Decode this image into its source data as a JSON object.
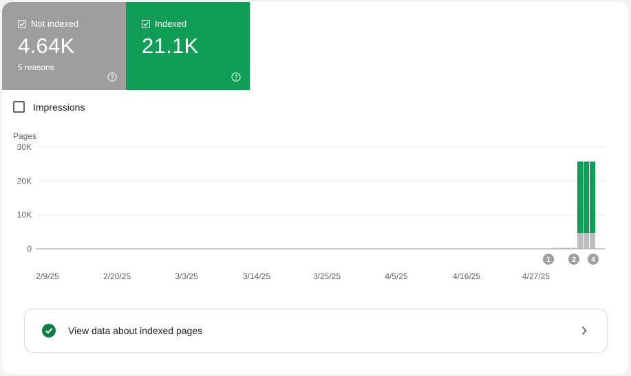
{
  "tiles": {
    "not_indexed": {
      "label": "Not indexed",
      "value": "4.64K",
      "sub": "5 reasons",
      "color": "#9e9e9e"
    },
    "indexed": {
      "label": "Indexed",
      "value": "21.1K",
      "color": "#0f9d58"
    }
  },
  "impressions": {
    "label": "Impressions",
    "checked": false
  },
  "chart_data": {
    "type": "bar",
    "stacked": true,
    "ylabel": "Pages",
    "ylim": [
      0,
      30000
    ],
    "yticks": [
      "30K",
      "20K",
      "10K",
      "0"
    ],
    "ytick_values": [
      30000,
      20000,
      10000,
      0
    ],
    "xticks": [
      "2/9/25",
      "2/20/25",
      "3/3/25",
      "3/14/25",
      "3/25/25",
      "4/5/25",
      "4/16/25",
      "4/27/25"
    ],
    "x": [
      "5/1/25",
      "5/2/25",
      "5/3/25",
      "5/4/25",
      "5/5/25",
      "5/6/25",
      "5/7/25"
    ],
    "series": [
      {
        "color": "#bdbdbd",
        "values": [
          300,
          300,
          300,
          300,
          4640,
          4640,
          4640
        ]
      },
      {
        "color": "#0f9d58",
        "values": [
          0,
          0,
          0,
          0,
          21100,
          21100,
          21100
        ]
      }
    ],
    "annotations": [
      "1",
      "2",
      "4"
    ],
    "grid": true
  },
  "footer": {
    "link_label": "View data about indexed pages"
  }
}
